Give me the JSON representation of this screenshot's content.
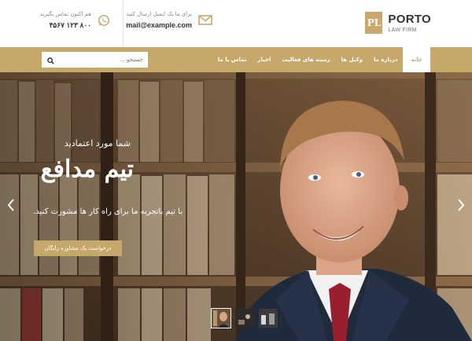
{
  "brand": {
    "mark": "PL",
    "name": "PORTO",
    "sub": "LAW FIRM",
    "accent": "#c6a86b"
  },
  "contact": {
    "email_label": "برای ما یک ایمیل ارسال کنید",
    "email_value": "mail@example.com",
    "phone_label": "هم اکنون تماس بگیرید",
    "phone_value": "۸۰۰ ۱۲۳ ۴۵۶۷"
  },
  "nav": {
    "items": [
      "خانه",
      "درباره ما",
      "وکیل ها",
      "زمینه های فعالیت",
      "اخبار",
      "تماس با ما"
    ],
    "active_index": 0
  },
  "search": {
    "placeholder": "جستجو ..."
  },
  "hero": {
    "subtitle": "شما مورد اعتمادید",
    "title": "تیم مدافع",
    "description": "با تیم باتجربه ما برای راه کار ها مشورت کنید.",
    "button": "درخواست یک مشاوره رایگان"
  },
  "slider": {
    "thumb_count": 3,
    "active_thumb": 0
  }
}
